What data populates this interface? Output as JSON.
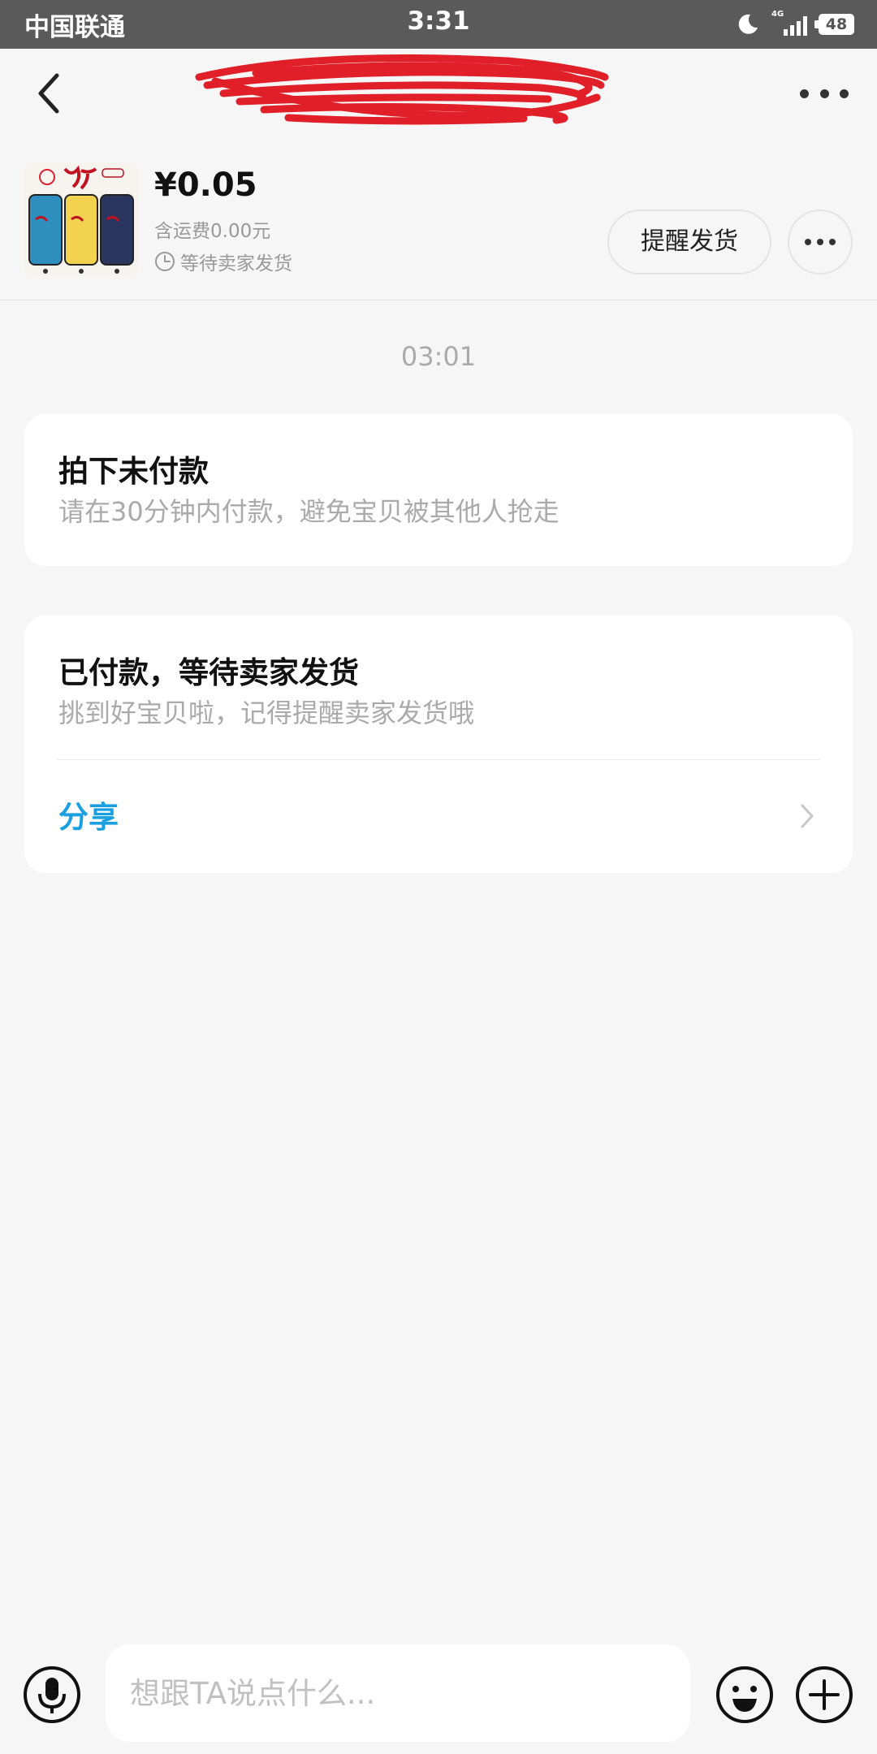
{
  "status_bar": {
    "carrier": "中国联通",
    "time": "3:31",
    "network": "4G",
    "battery": "48",
    "icons": [
      "moon-icon",
      "signal-icon",
      "battery-icon"
    ]
  },
  "nav": {
    "title": "",
    "back_icon": "chevron-left-icon",
    "more_icon": "more-dots-icon"
  },
  "product": {
    "price": "¥0.05",
    "shipping": "含运费0.00元",
    "status": "等待卖家发货",
    "status_icon": "clock-icon",
    "remind_button": "提醒发货",
    "more_icon": "more-dots-icon"
  },
  "chat": {
    "time": "03:01",
    "cards": [
      {
        "title": "拍下未付款",
        "subtitle": "请在30分钟内付款，避免宝贝被其他人抢走"
      },
      {
        "title": "已付款，等待卖家发货",
        "subtitle": "挑到好宝贝啦，记得提醒卖家发货哦",
        "action": "分享",
        "action_icon": "chevron-right-icon"
      }
    ]
  },
  "input_bar": {
    "placeholder": "想跟TA说点什么...",
    "mic_icon": "microphone-icon",
    "emoji_icon": "emoji-icon",
    "plus_icon": "plus-icon"
  },
  "colors": {
    "background": "#f6f6f6",
    "status_bar": "#5a5a5a",
    "accent": "#1a9fe0",
    "annotation_scribble": "#e0141e"
  }
}
